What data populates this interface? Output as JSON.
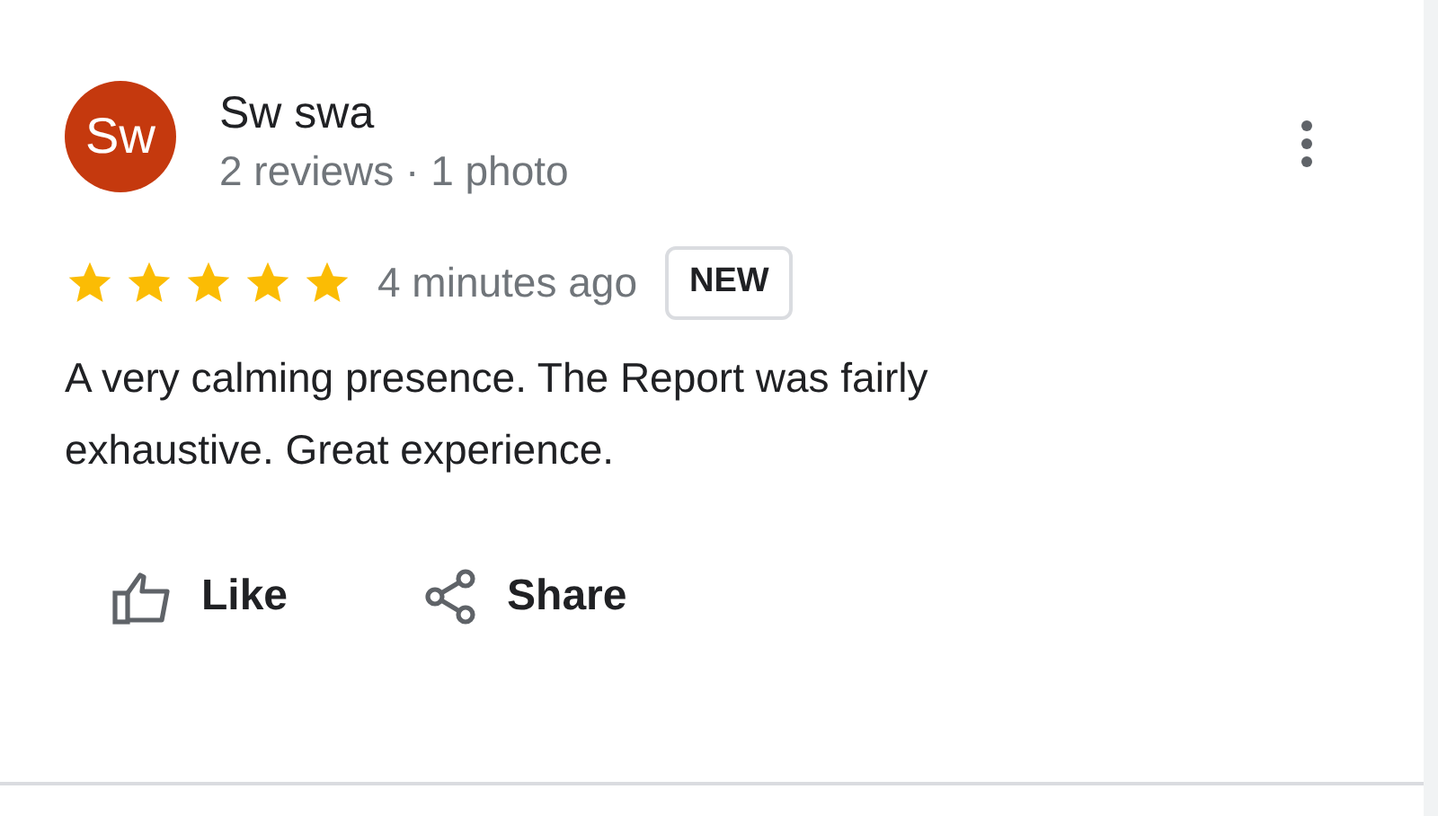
{
  "reviewer": {
    "initials": "Sw",
    "name": "Sw swa",
    "meta": "2 reviews · 1 photo"
  },
  "review": {
    "stars": 5,
    "time": "4 minutes ago",
    "badge": "NEW",
    "text": "A very calming presence. The Report was fairly exhaustive. Great experience."
  },
  "actions": [
    {
      "kind": "like",
      "label": "Like"
    },
    {
      "kind": "share",
      "label": "Share"
    }
  ]
}
